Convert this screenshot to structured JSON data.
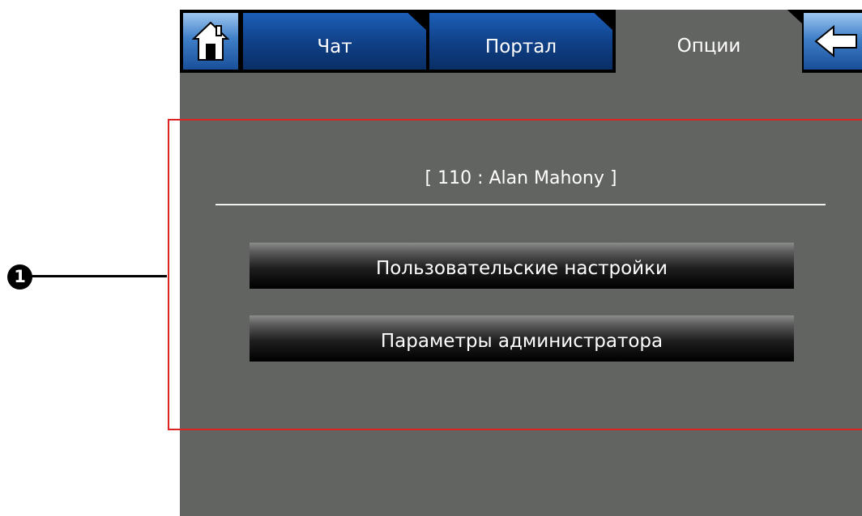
{
  "tabs": {
    "home_icon": "house-icon",
    "chat_label": "Чат",
    "portal_label": "Портал",
    "options_label": "Опции",
    "back_icon": "arrow-left-icon"
  },
  "main": {
    "user_label": "[ 110 : Alan Mahony ]",
    "user_settings_button": "Пользовательские настройки",
    "admin_settings_button": "Параметры администратора"
  },
  "callout": {
    "number": "1"
  },
  "colors": {
    "screen_background": "#626461",
    "tab_blue": "#1c5fb8",
    "highlight_red": "#dd2222"
  }
}
